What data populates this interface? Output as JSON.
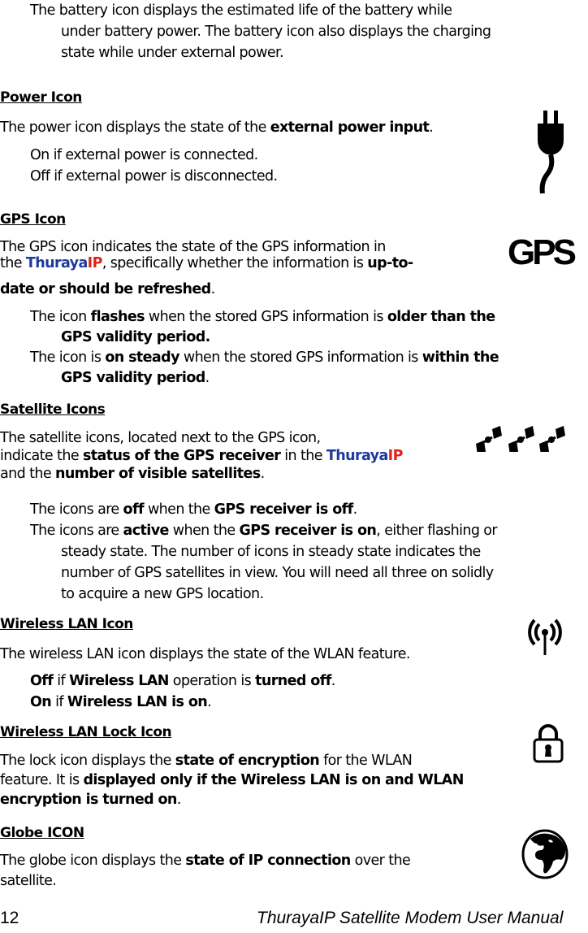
{
  "battery": {
    "line1": "The battery icon displays the estimated life of the battery while",
    "line2": "under battery power. The battery icon also displays the charging",
    "line3": "state while under external power."
  },
  "power": {
    "heading": "Power Icon",
    "desc_pre": "The power icon displays the state of the ",
    "desc_bold": "external power input",
    "desc_post": ".",
    "item1": "On if external power is connected.",
    "item2": "Off if external power is disconnected.",
    "icon": "power-plug-icon"
  },
  "gps": {
    "heading": "GPS Icon",
    "line1": "The GPS icon indicates the state of the GPS information in",
    "line2_pre": "the ",
    "brand_a": "Thuraya",
    "brand_b": "IP",
    "line2_mid": ", specifically whether the information is ",
    "line2_bold": "up-to-",
    "line3_bold": "date or should be refreshed",
    "line3_post": ".",
    "icon_text": "GPS",
    "item1_pre": "The icon ",
    "item1_b1": "flashes",
    "item1_mid": " when the stored GPS information is ",
    "item1_b2": "older than the",
    "item1_b3": "GPS validity period.",
    "item2_pre": "The icon is ",
    "item2_b1": "on steady",
    "item2_mid": " when the stored GPS information is ",
    "item2_b2": "within the",
    "item2_b3": "GPS validity period",
    "item2_post": "."
  },
  "satellite": {
    "heading": "Satellite Icons",
    "line1": "The satellite icons, located next to the GPS icon,",
    "line2_pre": "indicate the ",
    "line2_bold": "status of the GPS receiver",
    "line2_mid": " in the ",
    "brand_a": "Thuraya",
    "brand_b": "IP",
    "line3_pre": "and the ",
    "line3_bold": "number of visible satellites",
    "line3_post": ".",
    "item1_pre": "The icons are ",
    "item1_b1": "off",
    "item1_mid": " when the ",
    "item1_b2": "GPS receiver is off",
    "item1_post": ".",
    "item2_pre": "The icons are ",
    "item2_b1": "active",
    "item2_mid": " when the ",
    "item2_b2": "GPS receiver is on",
    "item2_post": ", either flashing or",
    "item2_l2": "steady state. The number of icons in steady state indicates the",
    "item2_l3": "number of GPS satellites in view. You will need all three on solidly",
    "item2_l4": "to acquire a new GPS location.",
    "icon": "satellite-icons"
  },
  "wlan": {
    "heading": "Wireless LAN Icon",
    "desc": "The wireless LAN icon displays the state of the WLAN feature.",
    "item1_b1": "Off",
    "item1_mid": " if ",
    "item1_b2": "Wireless LAN",
    "item1_mid2": " operation is ",
    "item1_b3": "turned off",
    "item1_post": ".",
    "item2_b1": "On",
    "item2_mid": " if ",
    "item2_b2": "Wireless LAN is on",
    "item2_post": ".",
    "icon": "wireless-icon"
  },
  "lock": {
    "heading": "Wireless LAN Lock Icon",
    "line1_pre": "The lock icon displays the ",
    "line1_bold": "state of encryption",
    "line1_post": " for the WLAN",
    "line2_pre": "feature. It is ",
    "line2_bold": "displayed only if the Wireless LAN is on and WLAN",
    "line3_bold": "encryption is turned on",
    "line3_post": ".",
    "icon": "lock-icon"
  },
  "globe": {
    "heading": "Globe ICON",
    "line1_pre": "The globe icon displays the ",
    "line1_bold": "state of IP connection",
    "line1_post": " over the",
    "line2": "satellite.",
    "icon": "globe-icon"
  },
  "footer": {
    "page_number": "12",
    "title": "ThurayaIP Satellite Modem User Manual"
  }
}
